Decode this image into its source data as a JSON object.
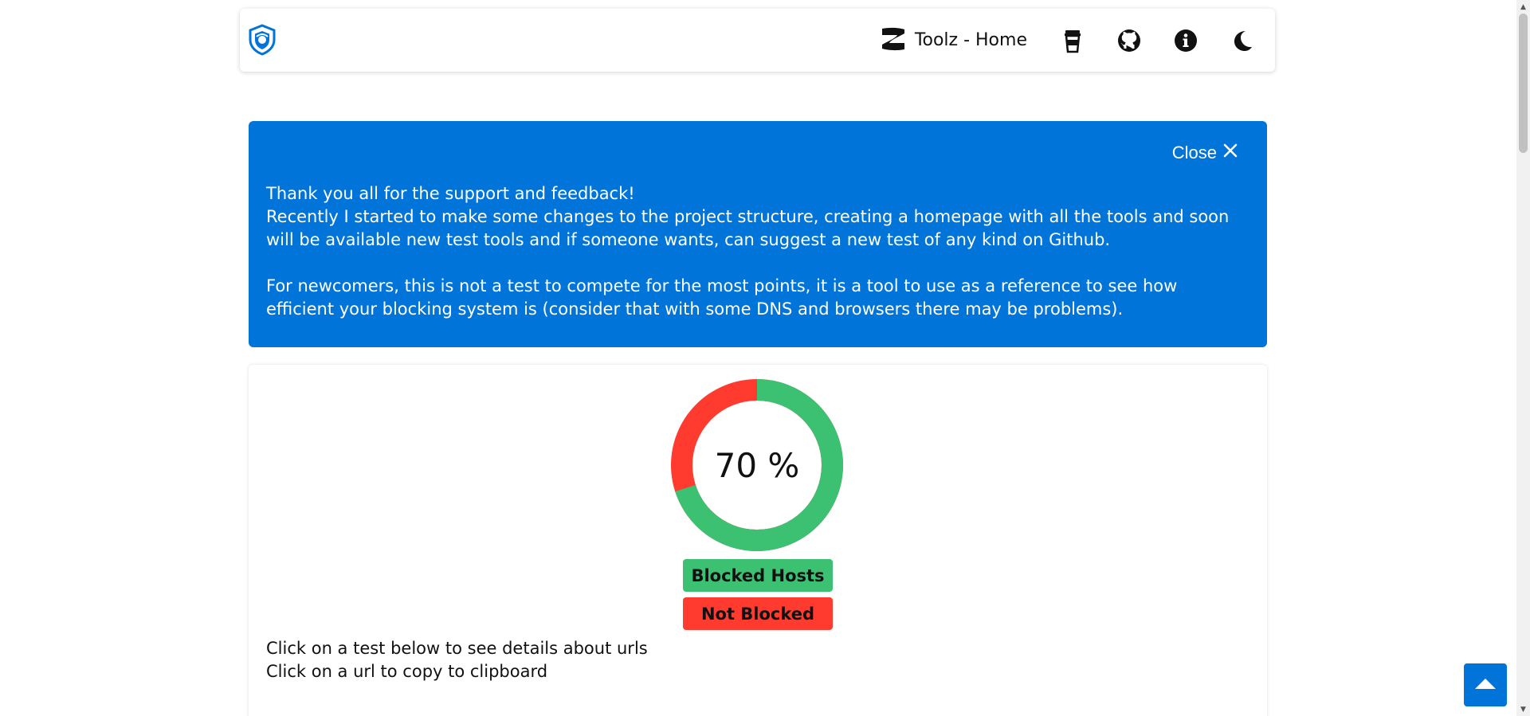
{
  "navbar": {
    "logo_icon": "shield-logo-icon",
    "toolz_label": "Toolz - Home",
    "icons": [
      "toolz-logo-icon",
      "coffee-cup-icon",
      "github-icon",
      "info-icon",
      "moon-icon"
    ]
  },
  "banner": {
    "close_label": "Close",
    "close_icon": "close-icon",
    "line1": "Thank you all for the support and feedback!",
    "line2": "Recently I started to make some changes to the project structure, creating a homepage with all the tools and soon will be available new test tools and if someone wants, can suggest a new test of any kind on Github.",
    "line3": "For newcomers, this is not a test to compete for the most points, it is a tool to use as a reference to see how efficient your blocking system is (consider that with some DNS and browsers there may be problems).",
    "background_color": "#0074d9"
  },
  "result": {
    "percent_label": "70 %",
    "blocked_fraction": 0.7,
    "blocked_label": "Blocked Hosts",
    "not_blocked_label": "Not Blocked",
    "blocked_color": "#3cc072",
    "not_blocked_color": "#ff3b30",
    "instruction1": "Click on a test below to see details about urls",
    "instruction2": "Click on a url to copy to clipboard"
  },
  "back_to_top_icon": "arrow-up-icon"
}
